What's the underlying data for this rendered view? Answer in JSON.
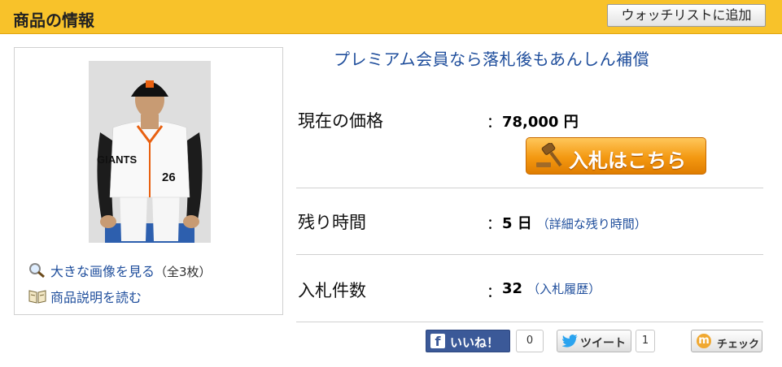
{
  "header": {
    "title": "商品の情報",
    "watchlist_button": "ウォッチリストに追加"
  },
  "image_panel": {
    "large_image_link": "大きな画像を見る",
    "image_count": "（全3枚）",
    "description_link": "商品説明を読む"
  },
  "promo_text": "プレミアム会員なら落札後もあんしん補償",
  "price": {
    "label": "現在の価格",
    "colon": "：",
    "value": "78,000 円"
  },
  "bid_button": "入札はこちら",
  "time_left": {
    "label": "残り時間",
    "colon": "：",
    "value": "5 日",
    "detail_link": "（詳細な残り時間）"
  },
  "bids": {
    "label": "入札件数",
    "colon": "：",
    "value": "32",
    "history_link": "（入札履歴）"
  },
  "social": {
    "facebook_label": "いいね！",
    "facebook_icon": "f",
    "facebook_count": "0",
    "twitter_label": "ツイート",
    "twitter_count": "1",
    "mixi_label": "チェック",
    "mixi_icon": "m"
  },
  "jersey": {
    "team": "GIANTS",
    "number": "26"
  },
  "colors": {
    "header_bg": "#f8c22a",
    "link": "#1f4e9c",
    "bid_button": "#f39811",
    "facebook": "#3b5998"
  }
}
